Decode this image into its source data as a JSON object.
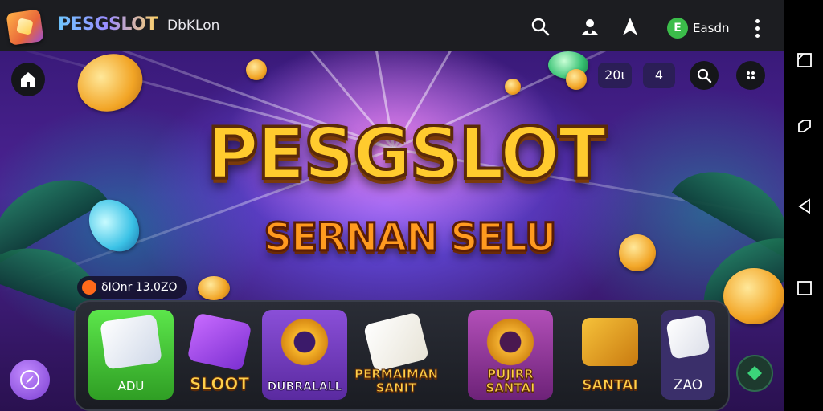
{
  "topbar": {
    "brand": "PESGSLOT",
    "brand_sub": "DbKLon",
    "balance": "Easdn",
    "balance_icon_letter": "E",
    "icons": [
      "search-icon",
      "user-icon",
      "navigate-icon",
      "more-icon"
    ]
  },
  "banner": {
    "title": "PESGSLOT",
    "subtitle": "SERNAN SELU",
    "hud_a": "20ι",
    "hud_b": "4",
    "promo": "δIOnr 13.0ZO"
  },
  "games": [
    {
      "label": "ADU",
      "icon": "dice-icon"
    },
    {
      "label": "SLOOT",
      "icon": "card-icon"
    },
    {
      "label": "DUBRALALL",
      "icon": "ring-icon"
    },
    {
      "label": "PERMAIMAN SANIT",
      "icon": "cards-icon"
    },
    {
      "label": "PUJIRR SANTAI",
      "icon": "ring-icon"
    },
    {
      "label": "SANTAI",
      "icon": "slot-machine-icon"
    },
    {
      "label": "ZAO",
      "icon": "dice-icon"
    }
  ],
  "colors": {
    "topbar": "#1c1d21",
    "title_gold": "#ffcb2e",
    "tray": "#1a1c22",
    "active_tile": "#5ce64b"
  }
}
